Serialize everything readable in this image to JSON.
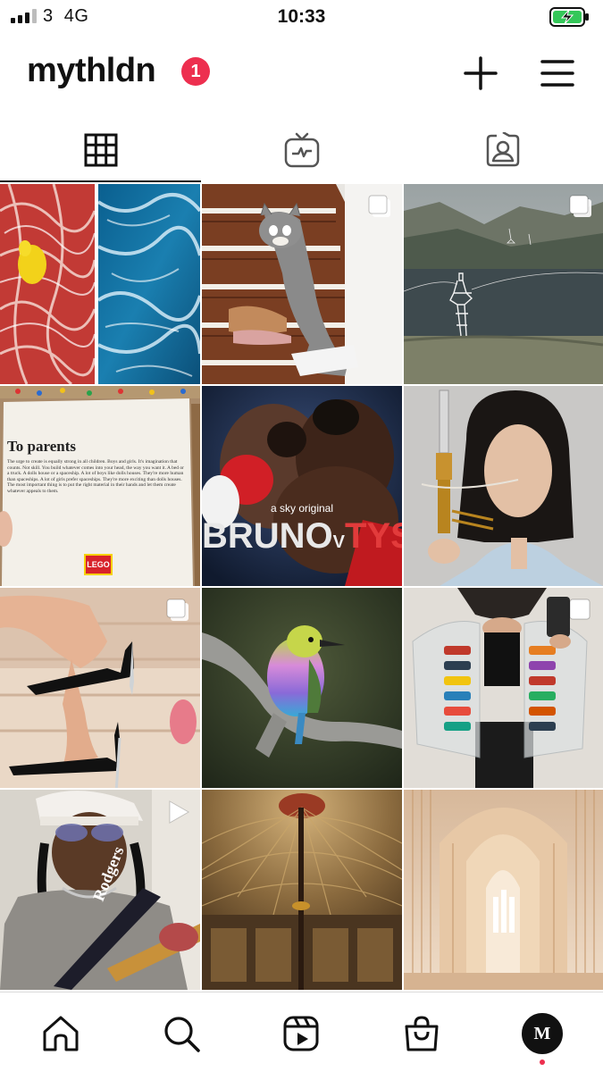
{
  "status_bar": {
    "carrier": "3",
    "network": "4G",
    "time": "10:33",
    "signal_bars_filled": 3,
    "signal_bars_total": 4,
    "battery_state": "charging",
    "battery_color": "#34c759"
  },
  "header": {
    "username": "mythldn",
    "notification_count": "1",
    "badge_color": "#ed2f4f",
    "new_post_icon": "plus-icon",
    "menu_icon": "hamburger-menu-icon"
  },
  "tabs": [
    {
      "id": "posts",
      "icon": "grid-icon",
      "active": true
    },
    {
      "id": "igtv",
      "icon": "tv-icon",
      "active": false
    },
    {
      "id": "tagged",
      "icon": "tagged-person-icon",
      "active": false
    }
  ],
  "grid": {
    "posts": [
      {
        "id": 1,
        "subject": "red sand and ocean split image",
        "overlay": "none"
      },
      {
        "id": 2,
        "subject": "tom cat stair runner with sneakers",
        "overlay": "multiple-posts-icon"
      },
      {
        "id": 3,
        "subject": "pylon figure sculpture by fjord",
        "overlay": "multiple-posts-icon"
      },
      {
        "id": 4,
        "subject": "lego to parents letter",
        "overlay": "none",
        "text": {
          "heading": "To parents",
          "body": "The urge to create is equally strong in all children. Boys and girls. It's imagination that counts. Not skill. You build whatever comes into your head, the way you want it. A bed or a truck. A dolls house or a spaceship. A lot of boys like dolls houses. They're more human than spaceships. A lot of girls prefer spaceships. They're more exciting than dolls houses. The most important thing is to put the right material in their hands and let them create whatever appeals to them.",
          "brand": "LEGO"
        }
      },
      {
        "id": 5,
        "subject": "bruno v tyson poster",
        "overlay": "none",
        "text": {
          "tagline": "a sky original",
          "title_left": "BRUNO",
          "title_mid": "V",
          "title_right": "TYSON"
        }
      },
      {
        "id": 6,
        "subject": "woman with nose tube device",
        "overlay": "none"
      },
      {
        "id": 7,
        "subject": "knife heel shoes",
        "overlay": "multiple-posts-icon"
      },
      {
        "id": 8,
        "subject": "lilac-breasted roller bird",
        "overlay": "none"
      },
      {
        "id": 9,
        "subject": "toy car pocket jacket",
        "overlay": "single-post-icon"
      },
      {
        "id": 10,
        "subject": "man with guitar video",
        "overlay": "play-video-icon",
        "text": {
          "shirt": "Rodgers"
        }
      },
      {
        "id": 11,
        "subject": "ornate dome ceiling",
        "overlay": "none"
      },
      {
        "id": 12,
        "subject": "church nave architecture",
        "overlay": "none"
      }
    ]
  },
  "bottom_nav": {
    "items": [
      "home-icon",
      "search-icon",
      "reels-icon",
      "shop-icon",
      "profile-avatar"
    ],
    "avatar_label": "M",
    "active_dot_color": "#ed2f4f"
  }
}
